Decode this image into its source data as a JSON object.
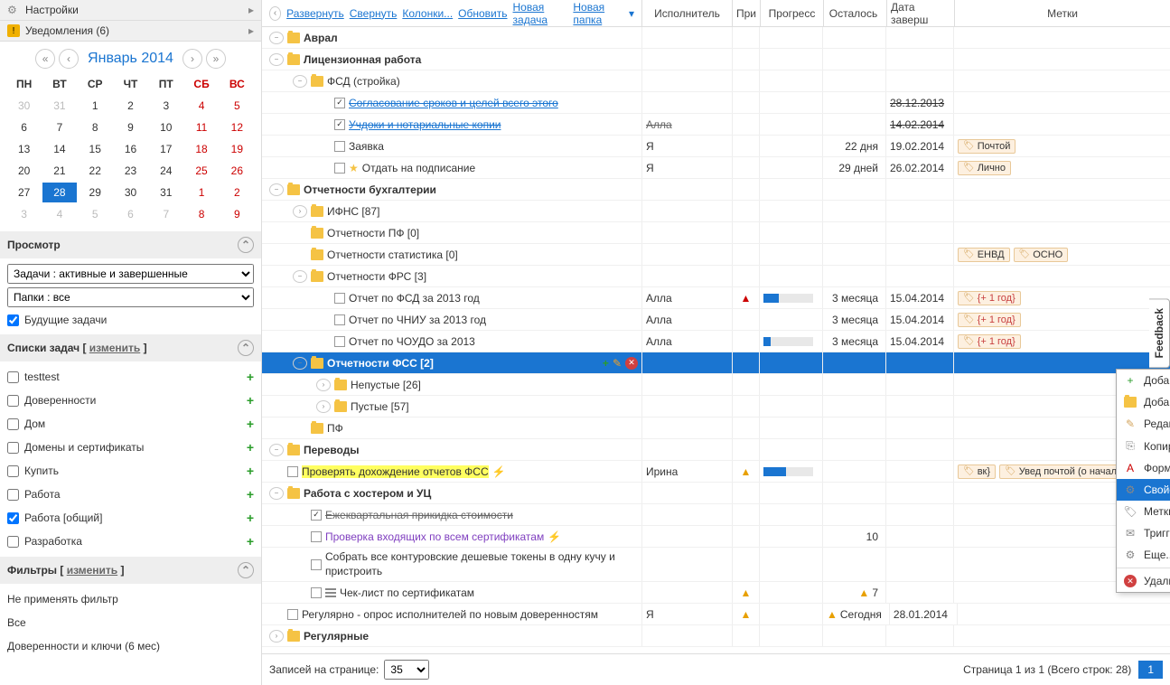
{
  "sidebar": {
    "settings": "Настройки",
    "notifications": "Уведомления (6)"
  },
  "calendar": {
    "title": "Январь 2014",
    "weekdays": [
      "ПН",
      "ВТ",
      "СР",
      "ЧТ",
      "ПТ",
      "СБ",
      "ВС"
    ],
    "cells": [
      {
        "d": "30",
        "out": true
      },
      {
        "d": "31",
        "out": true
      },
      {
        "d": "1"
      },
      {
        "d": "2"
      },
      {
        "d": "3"
      },
      {
        "d": "4",
        "w": true
      },
      {
        "d": "5",
        "w": true
      },
      {
        "d": "6"
      },
      {
        "d": "7"
      },
      {
        "d": "8"
      },
      {
        "d": "9"
      },
      {
        "d": "10"
      },
      {
        "d": "11",
        "w": true
      },
      {
        "d": "12",
        "w": true
      },
      {
        "d": "13"
      },
      {
        "d": "14"
      },
      {
        "d": "15"
      },
      {
        "d": "16"
      },
      {
        "d": "17"
      },
      {
        "d": "18",
        "w": true
      },
      {
        "d": "19",
        "w": true
      },
      {
        "d": "20"
      },
      {
        "d": "21"
      },
      {
        "d": "22"
      },
      {
        "d": "23"
      },
      {
        "d": "24"
      },
      {
        "d": "25",
        "w": true
      },
      {
        "d": "26",
        "w": true
      },
      {
        "d": "27"
      },
      {
        "d": "28",
        "today": true
      },
      {
        "d": "29"
      },
      {
        "d": "30"
      },
      {
        "d": "31"
      },
      {
        "d": "1",
        "out": true,
        "w": true
      },
      {
        "d": "2",
        "out": true,
        "w": true
      },
      {
        "d": "3",
        "out": true
      },
      {
        "d": "4",
        "out": true
      },
      {
        "d": "5",
        "out": true
      },
      {
        "d": "6",
        "out": true
      },
      {
        "d": "7",
        "out": true
      },
      {
        "d": "8",
        "out": true,
        "w": true
      },
      {
        "d": "9",
        "out": true,
        "w": true
      }
    ]
  },
  "view": {
    "title": "Просмотр",
    "tasks_select": "Задачи : активные и завершенные",
    "folders_select": "Папки : все",
    "future_label": "Будущие задачи"
  },
  "tasklists": {
    "title_a": "Списки задач [ ",
    "title_link": "изменить",
    "title_b": " ]",
    "items": [
      {
        "label": "testtest",
        "checked": false
      },
      {
        "label": "Доверенности",
        "checked": false
      },
      {
        "label": "Дом",
        "checked": false
      },
      {
        "label": "Домены и сертификаты",
        "checked": false
      },
      {
        "label": "Купить",
        "checked": false
      },
      {
        "label": "Работа",
        "checked": false
      },
      {
        "label": "Работа [общий]",
        "checked": true
      },
      {
        "label": "Разработка",
        "checked": false
      }
    ]
  },
  "filters": {
    "title_a": "Фильтры [ ",
    "title_link": "изменить",
    "title_b": " ]",
    "items": [
      "Не применять фильтр",
      "Все",
      "Доверенности и ключи (6 мес)"
    ]
  },
  "toolbar": {
    "expand": "Развернуть",
    "collapse": "Свернуть",
    "columns": "Колонки...",
    "refresh": "Обновить",
    "new_task": "Новая задача",
    "new_folder": "Новая папка"
  },
  "columns": {
    "assignee": "Исполнитель",
    "pri": "При",
    "progress": "Прогресс",
    "remaining": "Осталось",
    "due": "Дата заверш",
    "tags": "Метки"
  },
  "rows": [
    {
      "indent": 0,
      "type": "folder",
      "bold": true,
      "label": "Аврал",
      "exp": "-"
    },
    {
      "indent": 0,
      "type": "folder",
      "bold": true,
      "label": "Лицензионная работа",
      "exp": "-"
    },
    {
      "indent": 1,
      "type": "folder",
      "label": "ФСД (стройка)",
      "exp": "-"
    },
    {
      "indent": 2,
      "type": "task",
      "checked": true,
      "strike": true,
      "link": true,
      "label": "Согласование сроков и целей всего этого",
      "date": "28.12.2013",
      "dstrike": true
    },
    {
      "indent": 2,
      "type": "task",
      "checked": true,
      "strike": true,
      "link": true,
      "label": "Учдоки и нотариальные копии",
      "assign": "Алла",
      "astrike": true,
      "date": "14.02.2014",
      "dstrike": true
    },
    {
      "indent": 2,
      "type": "task",
      "label": "Заявка",
      "assign": "Я",
      "left": "22 дня",
      "date": "19.02.2014",
      "tags": [
        "Почтой"
      ]
    },
    {
      "indent": 2,
      "type": "task",
      "star": true,
      "label": "Отдать на подписание",
      "assign": "Я",
      "left": "29 дней",
      "date": "26.02.2014",
      "tags": [
        "Лично"
      ]
    },
    {
      "indent": 0,
      "type": "folder",
      "bold": true,
      "label": "Отчетности бухгалтерии",
      "exp": "-"
    },
    {
      "indent": 1,
      "type": "folder",
      "label": "ИФНС [87]",
      "exp": "+"
    },
    {
      "indent": 1,
      "type": "folder",
      "label": "Отчетности ПФ [0]"
    },
    {
      "indent": 1,
      "type": "folder",
      "label": "Отчетности статистика [0]",
      "tags": [
        "ЕНВД",
        "ОСНО"
      ]
    },
    {
      "indent": 1,
      "type": "folder",
      "label": "Отчетности ФРС [3]",
      "exp": "-"
    },
    {
      "indent": 2,
      "type": "task",
      "label": "Отчет по ФСД за 2013 год",
      "assign": "Алла",
      "pri": "red",
      "prog": 30,
      "left": "3 месяца",
      "date": "15.04.2014",
      "tags": [
        "{+ 1 год}"
      ],
      "tagred": true
    },
    {
      "indent": 2,
      "type": "task",
      "label": "Отчет по ЧНИУ за 2013 год",
      "assign": "Алла",
      "left": "3 месяца",
      "date": "15.04.2014",
      "tags": [
        "{+ 1 год}"
      ],
      "tagred": true
    },
    {
      "indent": 2,
      "type": "task",
      "label": "Отчет по ЧОУДО за 2013",
      "assign": "Алла",
      "prog": 15,
      "left": "3 месяца",
      "date": "15.04.2014",
      "tags": [
        "{+ 1 год}"
      ],
      "tagred": true
    },
    {
      "indent": 1,
      "type": "folder",
      "bold": true,
      "label": "Отчетности ФСС [2]",
      "exp": "-",
      "selected": true,
      "actions": true
    },
    {
      "indent": 2,
      "type": "folder",
      "label": "Непустые [26]",
      "exp": "+"
    },
    {
      "indent": 2,
      "type": "folder",
      "label": "Пустые [57]",
      "exp": "+"
    },
    {
      "indent": 1,
      "type": "folder",
      "label": "ПФ"
    },
    {
      "indent": 0,
      "type": "folder",
      "bold": true,
      "label": "Переводы",
      "exp": "-"
    },
    {
      "indent": 0,
      "type": "task",
      "hl": true,
      "label": "Проверять дохождение отчетов ФСС",
      "bolt": true,
      "assign": "Ирина",
      "pri": "yel",
      "prog": 45,
      "tags": [
        "вк}",
        "Увед почтой (о начале)"
      ],
      "tagvisible": true
    },
    {
      "indent": 0,
      "type": "folder",
      "bold": true,
      "label": "Работа с хостером и УЦ",
      "exp": "-"
    },
    {
      "indent": 1,
      "type": "task",
      "checked": true,
      "strike": true,
      "label": "Ежеквартальная прикидка стоимости"
    },
    {
      "indent": 1,
      "type": "task",
      "purple": true,
      "label": "Проверка входящих по всем сертификатам",
      "bolt": true,
      "left": "10"
    },
    {
      "indent": 1,
      "type": "task",
      "wrap": true,
      "label": "Собрать все контуровские дешевые токены в одну кучу и пристроить"
    },
    {
      "indent": 1,
      "type": "task",
      "listicon": true,
      "label": "Чек-лист по сертификатам",
      "pri": "yel",
      "left": "7"
    },
    {
      "indent": 0,
      "type": "task",
      "label": "Регулярно - опрос исполнителей по новым доверенностям",
      "assign": "Я",
      "pri": "yel",
      "left": "Сегодня",
      "date": "28.01.2014"
    },
    {
      "indent": 0,
      "type": "folder",
      "bold": true,
      "label": "Регулярные",
      "exp": "+"
    }
  ],
  "context_menu": [
    {
      "icon": "+",
      "color": "#2a9d2a",
      "label": "Добавить задачу"
    },
    {
      "icon": "folder",
      "label": "Добавить папку"
    },
    {
      "icon": "✎",
      "color": "#d4a55e",
      "label": "Редактировать"
    },
    {
      "icon": "⎘",
      "label": "Копировать"
    },
    {
      "icon": "A",
      "color": "#c00",
      "label": "Формат",
      "arrow": true
    },
    {
      "icon": "⚙",
      "label": "Свойства",
      "active": true
    },
    {
      "icon": "🏷",
      "label": "Метки"
    },
    {
      "icon": "✉",
      "label": "Триггеры"
    },
    {
      "icon": "⚙",
      "label": "Еще...",
      "arrow": true
    },
    {
      "sep": true
    },
    {
      "icon": "✕",
      "color": "#c00",
      "bg": true,
      "label": "Удалить"
    }
  ],
  "footer": {
    "per_page_label": "Записей на странице:",
    "per_page_value": "35",
    "page_info": "Страница 1 из 1  (Всего строк: 28)",
    "page_num": "1"
  },
  "feedback": "Feedback"
}
